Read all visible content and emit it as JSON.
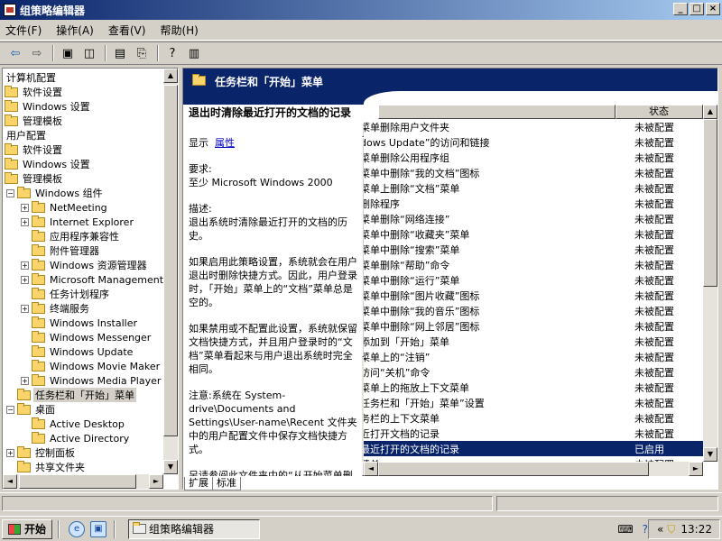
{
  "window": {
    "title": "组策略编辑器",
    "min": "_",
    "max": "□",
    "close": "×"
  },
  "menu": [
    "文件(F)",
    "操作(A)",
    "查看(V)",
    "帮助(H)"
  ],
  "tree": [
    {
      "label": "计算机配置",
      "indent": 0,
      "pm": "",
      "folder": false
    },
    {
      "label": "软件设置",
      "indent": 0,
      "pm": "",
      "folder": true
    },
    {
      "label": "Windows 设置",
      "indent": 0,
      "pm": "",
      "folder": true
    },
    {
      "label": "管理模板",
      "indent": 0,
      "pm": "",
      "folder": true
    },
    {
      "label": "用户配置",
      "indent": 0,
      "pm": "",
      "folder": false
    },
    {
      "label": "软件设置",
      "indent": 0,
      "pm": "",
      "folder": true
    },
    {
      "label": "Windows 设置",
      "indent": 0,
      "pm": "",
      "folder": true
    },
    {
      "label": "管理模板",
      "indent": 0,
      "pm": "",
      "folder": true
    },
    {
      "label": "Windows 组件",
      "indent": 1,
      "pm": "−",
      "folder": true
    },
    {
      "label": "NetMeeting",
      "indent": 2,
      "pm": "+",
      "folder": true
    },
    {
      "label": "Internet Explorer",
      "indent": 2,
      "pm": "+",
      "folder": true
    },
    {
      "label": "应用程序兼容性",
      "indent": 2,
      "pm": "",
      "folder": true
    },
    {
      "label": "附件管理器",
      "indent": 2,
      "pm": "",
      "folder": true
    },
    {
      "label": "Windows 资源管理器",
      "indent": 2,
      "pm": "+",
      "folder": true
    },
    {
      "label": "Microsoft Management",
      "indent": 2,
      "pm": "+",
      "folder": true
    },
    {
      "label": "任务计划程序",
      "indent": 2,
      "pm": "",
      "folder": true
    },
    {
      "label": "终端服务",
      "indent": 2,
      "pm": "+",
      "folder": true
    },
    {
      "label": "Windows Installer",
      "indent": 2,
      "pm": "",
      "folder": true
    },
    {
      "label": "Windows Messenger",
      "indent": 2,
      "pm": "",
      "folder": true
    },
    {
      "label": "Windows Update",
      "indent": 2,
      "pm": "",
      "folder": true
    },
    {
      "label": "Windows Movie Maker",
      "indent": 2,
      "pm": "",
      "folder": true
    },
    {
      "label": "Windows Media Player",
      "indent": 2,
      "pm": "+",
      "folder": true
    },
    {
      "label": "任务栏和「开始」菜单",
      "indent": 1,
      "pm": "",
      "folder": true,
      "selected": true
    },
    {
      "label": "桌面",
      "indent": 1,
      "pm": "−",
      "folder": true
    },
    {
      "label": "Active Desktop",
      "indent": 2,
      "pm": "",
      "folder": true
    },
    {
      "label": "Active Directory",
      "indent": 2,
      "pm": "",
      "folder": true
    },
    {
      "label": "控制面板",
      "indent": 1,
      "pm": "+",
      "folder": true
    },
    {
      "label": "共享文件夹",
      "indent": 1,
      "pm": "",
      "folder": true
    }
  ],
  "header": {
    "title": "任务栏和「开始」菜单"
  },
  "description": {
    "title": "退出时清除最近打开的文档的记录",
    "show_label": "显示",
    "show_link": "属性",
    "p1": "要求:\n至少 Microsoft Windows 2000",
    "p2": "描述:\n退出系统时清除最近打开的文档的历史。",
    "p3": "如果启用此策略设置，系统就会在用户退出时删除快捷方式。因此，用户登录时，「开始」菜单上的“文档”菜单总是空的。",
    "p4": "如果禁用或不配置此设置，系统就保留文档快捷方式，并且用户登录时的“文档”菜单看起来与用户退出系统时完全相同。",
    "p5": "注意:系统在 System-drive\\Documents and Settings\\User-name\\Recent 文件夹中的用户配置文件中保存文档快捷方式。",
    "p6": "另请参阅此文件夹中的“从开始菜单删除文档菜单”以及“不要保留"
  },
  "list_header": {
    "name": "",
    "state": "状态"
  },
  "list": [
    {
      "name": "菜单删除用户文件夹",
      "state": "未被配置"
    },
    {
      "name": "dows Update”的访问和链接",
      "state": "未被配置"
    },
    {
      "name": "菜单删除公用程序组",
      "state": "未被配置"
    },
    {
      "name": "菜单中删除“我的文档”图标",
      "state": "未被配置"
    },
    {
      "name": "菜单上删除“文档”菜单",
      "state": "未被配置"
    },
    {
      "name": "删除程序",
      "state": "未被配置"
    },
    {
      "name": "菜单删除“网络连接”",
      "state": "未被配置"
    },
    {
      "name": "菜单中删除“收藏夹”菜单",
      "state": "未被配置"
    },
    {
      "name": "菜单中删除“搜索”菜单",
      "state": "未被配置"
    },
    {
      "name": "菜单删除“帮助”命令",
      "state": "未被配置"
    },
    {
      "name": "菜单中删除“运行”菜单",
      "state": "未被配置"
    },
    {
      "name": "菜单中删除“图片收藏”图标",
      "state": "未被配置"
    },
    {
      "name": "菜单中删除“我的音乐”图标",
      "state": "未被配置"
    },
    {
      "name": "菜单中删除“网上邻居”图标",
      "state": "未被配置"
    },
    {
      "name": "添加到「开始」菜单",
      "state": "未被配置"
    },
    {
      "name": "菜单上的“注销”",
      "state": "未被配置"
    },
    {
      "name": "访问“关机”命令",
      "state": "未被配置"
    },
    {
      "name": "菜单上的拖放上下文菜单",
      "state": "未被配置"
    },
    {
      "name": "任务栏和「开始」菜单”设置",
      "state": "未被配置"
    },
    {
      "name": "务栏的上下文菜单",
      "state": "未被配置"
    },
    {
      "name": "近打开文档的记录",
      "state": "未被配置"
    },
    {
      "name": "最近打开的文档的记录",
      "state": "已启用",
      "selected": true
    },
    {
      "name": "菜单",
      "state": "未被配置"
    }
  ],
  "tabs": [
    "扩展",
    "标准"
  ],
  "taskbar": {
    "start": "开始",
    "task": "组策略编辑器",
    "tray_collapse": "«",
    "time": "13:22"
  }
}
